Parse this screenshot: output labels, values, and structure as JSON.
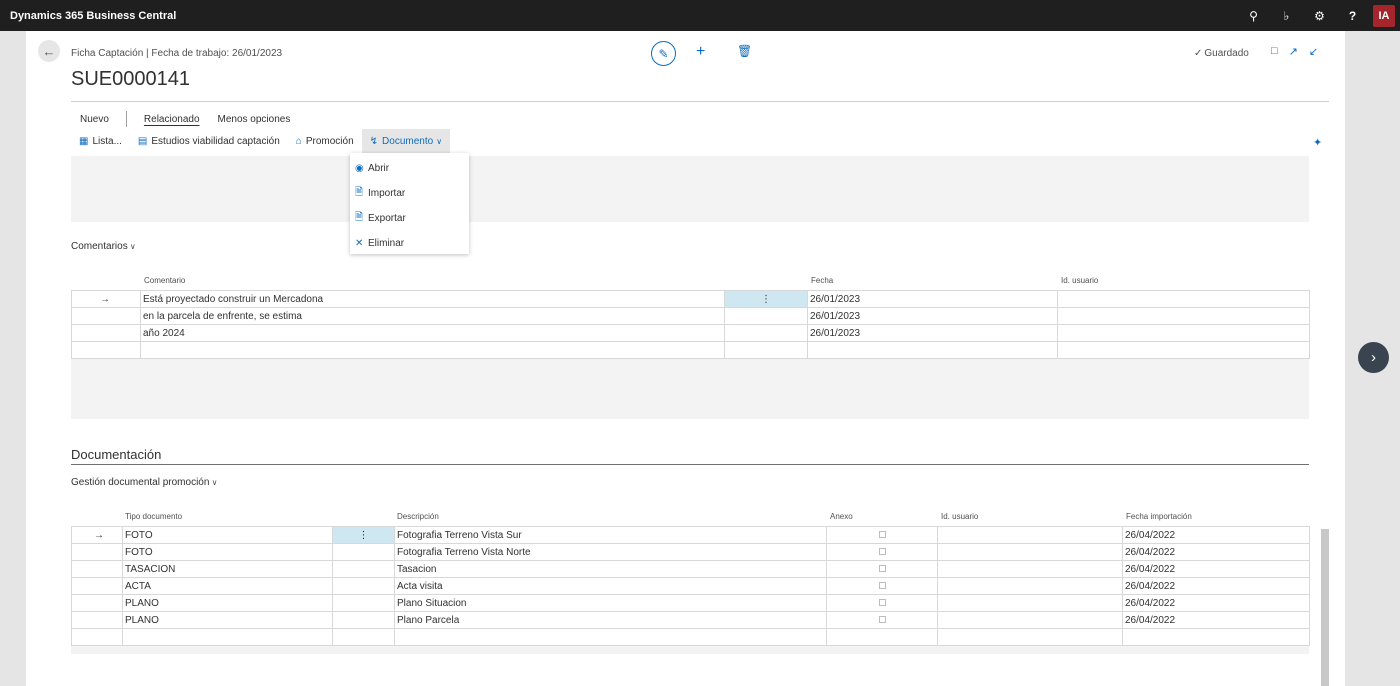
{
  "app": {
    "title": "Dynamics 365 Business Central",
    "avatar_initials": "IA"
  },
  "topbar_icons": [
    "search-icon",
    "bell-icon",
    "gear-icon",
    "help-icon"
  ],
  "header": {
    "breadcrumb": "Ficha Captación | Fecha de trabajo: 26/01/2023",
    "record_title": "SUE0000141",
    "saved_label": "Guardado"
  },
  "actions": {
    "row1": [
      {
        "label": "Nuevo"
      },
      {
        "label": "Relacionado"
      },
      {
        "label": "Menos opciones"
      }
    ],
    "row2": [
      {
        "label": "Lista..."
      },
      {
        "label": "Estudios viabilidad captación"
      },
      {
        "label": "Promoción"
      },
      {
        "label": "Documento"
      }
    ]
  },
  "document_menu": {
    "items": [
      {
        "label": "Abrir"
      },
      {
        "label": "Importar"
      },
      {
        "label": "Exportar"
      },
      {
        "label": "Eliminar"
      }
    ]
  },
  "comments": {
    "section_label": "Comentarios",
    "columns": [
      "Comentario",
      "Fecha",
      "Id. usuario"
    ],
    "rows": [
      {
        "comentario": "Está proyectado construir un Mercadona",
        "fecha": "26/01/2023",
        "usuario": ""
      },
      {
        "comentario": "en la parcela de enfrente, se estima",
        "fecha": "26/01/2023",
        "usuario": ""
      },
      {
        "comentario": "año 2024",
        "fecha": "26/01/2023",
        "usuario": ""
      }
    ]
  },
  "documentacion": {
    "title": "Documentación",
    "section_label": "Gestión documental promoción",
    "columns": [
      "Tipo documento",
      "Descripción",
      "Anexo",
      "Id. usuario",
      "Fecha importación"
    ],
    "rows": [
      {
        "tipo": "FOTO",
        "descripcion": "Fotografia Terreno Vista Sur",
        "fecha": "26/04/2022"
      },
      {
        "tipo": "FOTO",
        "descripcion": "Fotografia Terreno Vista Norte",
        "fecha": "26/04/2022"
      },
      {
        "tipo": "TASACION",
        "descripcion": "Tasacion",
        "fecha": "26/04/2022"
      },
      {
        "tipo": "ACTA",
        "descripcion": "Acta visita",
        "fecha": "26/04/2022"
      },
      {
        "tipo": "PLANO",
        "descripcion": "Plano Situacion",
        "fecha": "26/04/2022"
      },
      {
        "tipo": "PLANO",
        "descripcion": "Plano Parcela",
        "fecha": "26/04/2022"
      }
    ]
  }
}
